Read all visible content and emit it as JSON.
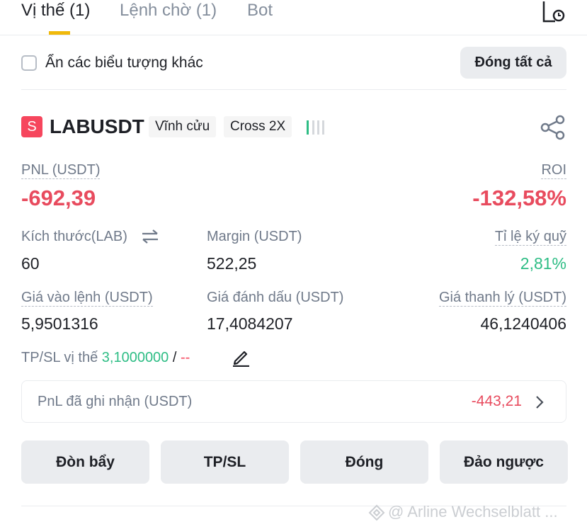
{
  "tabs": [
    {
      "label": "Vị thế (1)",
      "active": true
    },
    {
      "label": "Lệnh chờ (1)",
      "active": false
    },
    {
      "label": "Bot",
      "active": false
    }
  ],
  "filter": {
    "hide_other_symbols_label": "Ẩn các biểu tượng khác",
    "hide_other_symbols_checked": false,
    "close_all_label": "Đóng tất cả"
  },
  "position": {
    "side_badge": "S",
    "symbol": "LABUSDT",
    "contract_type": "Vĩnh cửu",
    "margin_mode": "Cross 2X",
    "pnl_label": "PNL (USDT)",
    "pnl_value": "-692,39",
    "roi_label": "ROI",
    "roi_value": "-132,58%",
    "size_label": "Kích thước(LAB)",
    "size_value": "60",
    "margin_label": "Margin (USDT)",
    "margin_value": "522,25",
    "margin_ratio_label": "Tỉ lệ ký quỹ",
    "margin_ratio_value": "2,81%",
    "entry_price_label": "Giá vào lệnh (USDT)",
    "entry_price_value": "5,9501316",
    "mark_price_label": "Giá đánh dấu (USDT)",
    "mark_price_value": "17,4084207",
    "liq_price_label": "Giá thanh lý (USDT)",
    "liq_price_value": "46,1240406",
    "tpsl_label": "TP/SL vị thế",
    "tp_value": "3,1000000",
    "tpsl_separator": "/",
    "sl_value": "--",
    "realized_pnl_label": "PnL đã ghi nhận (USDT)",
    "realized_pnl_value": "-443,21"
  },
  "actions": {
    "leverage": "Đòn bẩy",
    "tpsl": "TP/SL",
    "close": "Đóng",
    "reverse": "Đảo ngược"
  },
  "watermark": "@ Arline Wechselblatt ...",
  "colors": {
    "accent": "#f0b90b",
    "negative": "#e84b5e",
    "positive": "#2ebd85",
    "button_bg": "#eaecef"
  },
  "icons": [
    "history-icon",
    "share-icon",
    "swap-icon",
    "edit-icon",
    "chevron-right-icon",
    "signal-bars-icon",
    "watermark-logo-icon"
  ]
}
